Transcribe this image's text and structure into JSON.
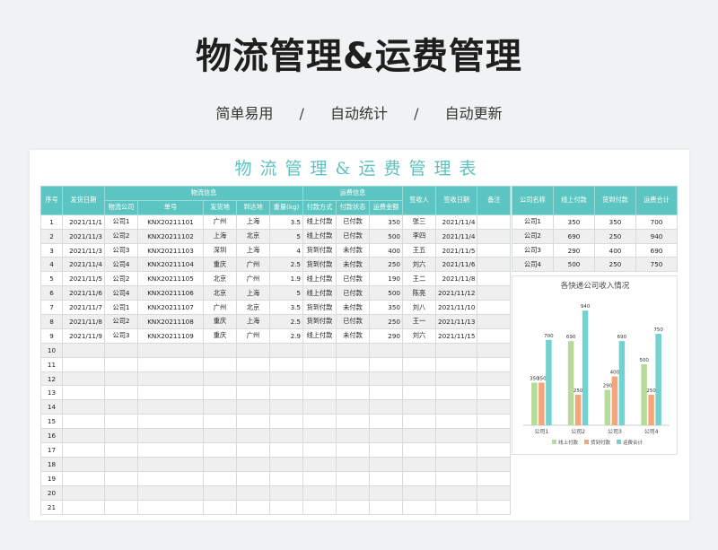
{
  "header": {
    "title": "物流管理&运费管理",
    "features": [
      "简单易用",
      "自动统计",
      "自动更新"
    ],
    "separator": "/"
  },
  "sheet": {
    "title": "物流管理&运费管理表"
  },
  "table": {
    "headers": {
      "seq": "序号",
      "ship_date": "发货日期",
      "logistics_group": "物流信息",
      "fee_group": "运费信息",
      "receiver": "签收人",
      "sign_date": "签收日期",
      "remark": "备注",
      "company": "物流公司",
      "order_no": "单号",
      "origin": "发货地",
      "dest": "到达地",
      "weight": "重量(kg)",
      "pay_method": "付款方式",
      "pay_status": "付款状态",
      "fee": "运费金额"
    },
    "rows": [
      [
        "1",
        "2021/11/1",
        "公司1",
        "KNX20211101",
        "广州",
        "上海",
        "3.5",
        "线上付款",
        "已付款",
        "350",
        "张三",
        "2021/11/4"
      ],
      [
        "2",
        "2021/11/3",
        "公司2",
        "KNX20211102",
        "上海",
        "北京",
        "5",
        "线上付款",
        "已付款",
        "500",
        "李四",
        "2021/11/4"
      ],
      [
        "3",
        "2021/11/3",
        "公司3",
        "KNX20211103",
        "深圳",
        "上海",
        "4",
        "货到付款",
        "未付款",
        "400",
        "王五",
        "2021/11/5"
      ],
      [
        "4",
        "2021/11/4",
        "公司4",
        "KNX20211104",
        "重庆",
        "广州",
        "2.5",
        "货到付款",
        "未付款",
        "250",
        "刘六",
        "2021/11/6"
      ],
      [
        "5",
        "2021/11/5",
        "公司2",
        "KNX20211105",
        "北京",
        "广州",
        "1.9",
        "线上付款",
        "已付款",
        "190",
        "王二",
        "2021/11/8"
      ],
      [
        "6",
        "2021/11/6",
        "公司4",
        "KNX20211106",
        "北京",
        "上海",
        "5",
        "线上付款",
        "已付款",
        "500",
        "陈亮",
        "2021/11/12"
      ],
      [
        "7",
        "2021/11/7",
        "公司1",
        "KNX20211107",
        "广州",
        "北京",
        "3.5",
        "货到付款",
        "未付款",
        "350",
        "刘八",
        "2021/11/10"
      ],
      [
        "8",
        "2021/11/8",
        "公司2",
        "KNX20211108",
        "重庆",
        "上海",
        "2.5",
        "货到付款",
        "已付款",
        "250",
        "王一",
        "2021/11/13"
      ],
      [
        "9",
        "2021/11/9",
        "公司3",
        "KNX20211109",
        "重庆",
        "广州",
        "2.9",
        "线上付款",
        "未付款",
        "290",
        "刘六",
        "2021/11/15"
      ]
    ],
    "empty_rows": [
      "10",
      "11",
      "12",
      "13",
      "14",
      "15",
      "16",
      "17",
      "18",
      "19",
      "20",
      "21"
    ]
  },
  "summary": {
    "headers": [
      "公司名称",
      "线上付款",
      "货到付款",
      "运费合计"
    ],
    "rows": [
      [
        "公司1",
        "350",
        "350",
        "700"
      ],
      [
        "公司2",
        "690",
        "250",
        "940"
      ],
      [
        "公司3",
        "290",
        "400",
        "690"
      ],
      [
        "公司4",
        "500",
        "250",
        "750"
      ]
    ]
  },
  "chart_data": {
    "type": "bar",
    "title": "各快递公司收入情况",
    "categories": [
      "公司1",
      "公司2",
      "公司3",
      "公司4"
    ],
    "series": [
      {
        "name": "线上付款",
        "values": [
          350,
          690,
          290,
          500
        ],
        "color": "#b7dc9a"
      },
      {
        "name": "货到付款",
        "values": [
          350,
          250,
          400,
          250
        ],
        "color": "#f5a57c"
      },
      {
        "name": "运费合计",
        "values": [
          700,
          940,
          690,
          750
        ],
        "color": "#72d2cf"
      }
    ],
    "ylim": [
      0,
      1000
    ],
    "legend": "bottom",
    "grid": false
  }
}
